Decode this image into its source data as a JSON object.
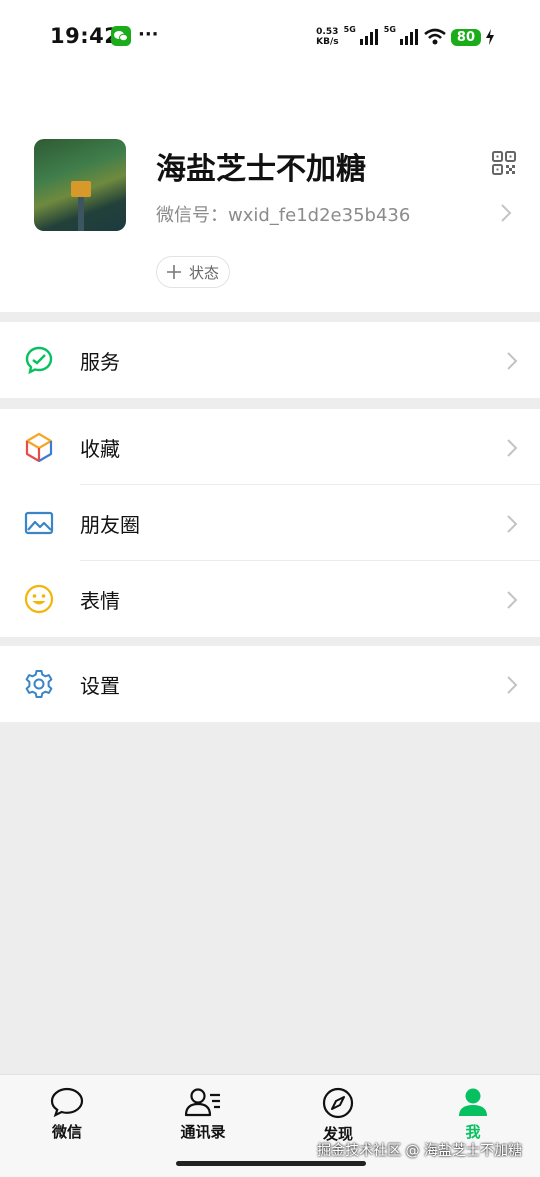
{
  "status_bar": {
    "time": "19:42",
    "net_speed_value": "0.53",
    "net_speed_unit": "KB/s",
    "sim1": "5G",
    "sim2": "5G",
    "battery": "80"
  },
  "profile": {
    "nickname": "海盐芝士不加糖",
    "wxid_label": "微信号：",
    "wxid_value": "wxid_fe1d2e35b436",
    "status_label": "状态"
  },
  "menu": {
    "service": "服务",
    "favorites": "收藏",
    "moments": "朋友圈",
    "stickers": "表情",
    "settings": "设置"
  },
  "tabs": [
    {
      "label": "微信",
      "icon": "chat-bubble-icon"
    },
    {
      "label": "通讯录",
      "icon": "contacts-icon"
    },
    {
      "label": "发现",
      "icon": "compass-icon"
    },
    {
      "label": "我",
      "icon": "person-icon"
    }
  ],
  "watermark": "掘金技术社区 @ 海盐芝士不加糖",
  "colors": {
    "brand_green": "#07c160",
    "background": "#ededed"
  }
}
